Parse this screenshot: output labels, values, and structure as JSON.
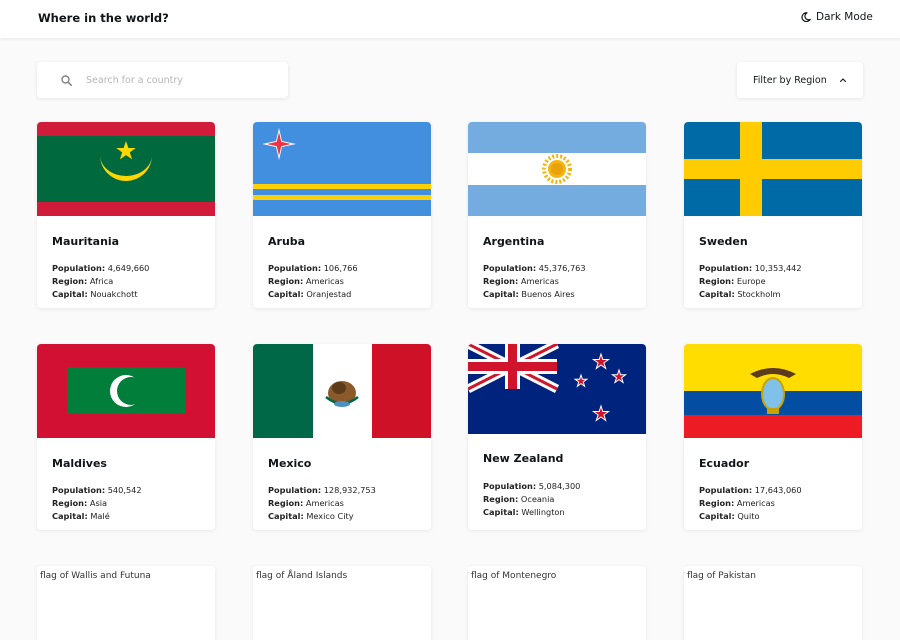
{
  "header": {
    "title": "Where in the world?",
    "dark_mode_label": "Dark Mode"
  },
  "search": {
    "placeholder": "Search for a country",
    "value": ""
  },
  "filter": {
    "label": "Filter by Region"
  },
  "labels": {
    "population": "Population:",
    "region": "Region:",
    "capital": "Capital:"
  },
  "countries": [
    {
      "name": "Mauritania",
      "population": "4,649,660",
      "region": "Africa",
      "capital": "Nouakchott"
    },
    {
      "name": "Aruba",
      "population": "106,766",
      "region": "Americas",
      "capital": "Oranjestad"
    },
    {
      "name": "Argentina",
      "population": "45,376,763",
      "region": "Americas",
      "capital": "Buenos Aires"
    },
    {
      "name": "Sweden",
      "population": "10,353,442",
      "region": "Europe",
      "capital": "Stockholm"
    },
    {
      "name": "Maldives",
      "population": "540,542",
      "region": "Asia",
      "capital": "Malé"
    },
    {
      "name": "Mexico",
      "population": "128,932,753",
      "region": "Americas",
      "capital": "Mexico City"
    },
    {
      "name": "New Zealand",
      "population": "5,084,300",
      "region": "Oceania",
      "capital": "Wellington"
    },
    {
      "name": "Ecuador",
      "population": "17,643,060",
      "region": "Americas",
      "capital": "Quito"
    }
  ],
  "pending_flags": [
    {
      "alt": "flag of Wallis and Futuna"
    },
    {
      "alt": "flag of Åland Islands"
    },
    {
      "alt": "flag of Montenegro"
    },
    {
      "alt": "flag of Pakistan"
    }
  ],
  "colors": {
    "background": "#fafafa",
    "element": "#ffffff",
    "text": "#111517",
    "placeholder": "#b6b6b6"
  }
}
